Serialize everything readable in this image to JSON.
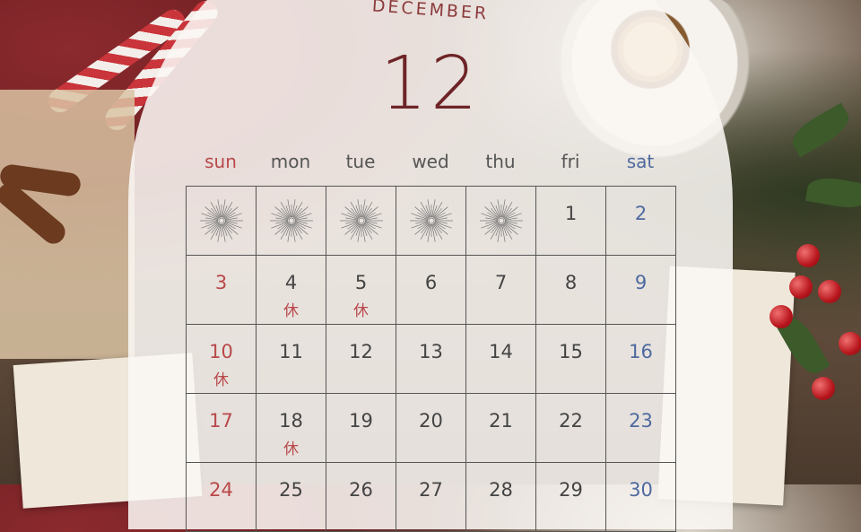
{
  "month_label": "DECEMBER",
  "month_number": "12",
  "weekdays": [
    "sun",
    "mon",
    "tue",
    "wed",
    "thu",
    "fri",
    "sat"
  ],
  "colors": {
    "sunday": "#b9484a",
    "saturday": "#4f6aa0",
    "text": "#444444",
    "title": "#6e2427"
  },
  "holiday_label": "休",
  "leading_blank_icon": "starburst-icon",
  "weeks": [
    [
      {
        "d": ""
      },
      {
        "d": ""
      },
      {
        "d": ""
      },
      {
        "d": ""
      },
      {
        "d": ""
      },
      {
        "d": "1"
      },
      {
        "d": "2"
      }
    ],
    [
      {
        "d": "3"
      },
      {
        "d": "4",
        "h": "休"
      },
      {
        "d": "5",
        "h": "休"
      },
      {
        "d": "6"
      },
      {
        "d": "7"
      },
      {
        "d": "8"
      },
      {
        "d": "9"
      }
    ],
    [
      {
        "d": "10",
        "h": "休"
      },
      {
        "d": "11"
      },
      {
        "d": "12"
      },
      {
        "d": "13"
      },
      {
        "d": "14"
      },
      {
        "d": "15"
      },
      {
        "d": "16"
      }
    ],
    [
      {
        "d": "17"
      },
      {
        "d": "18",
        "h": "休"
      },
      {
        "d": "19"
      },
      {
        "d": "20"
      },
      {
        "d": "21"
      },
      {
        "d": "22"
      },
      {
        "d": "23"
      }
    ],
    [
      {
        "d": "24"
      },
      {
        "d": "25"
      },
      {
        "d": "26"
      },
      {
        "d": "27"
      },
      {
        "d": "28"
      },
      {
        "d": "29"
      },
      {
        "d": "30"
      }
    ]
  ]
}
